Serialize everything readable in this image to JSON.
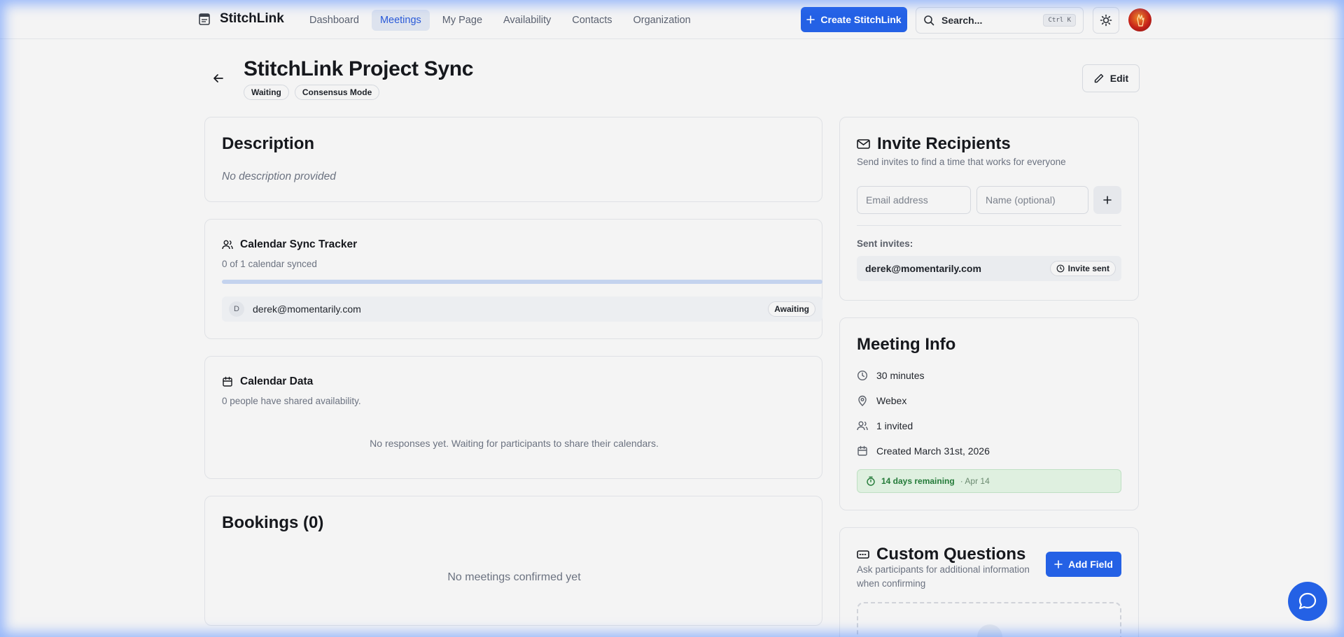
{
  "app": {
    "name": "StitchLink",
    "nav": [
      "Dashboard",
      "Meetings",
      "My Page",
      "Availability",
      "Contacts",
      "Organization"
    ],
    "active_nav": "Meetings",
    "create_button": "Create StitchLink",
    "search": {
      "label": "Search...",
      "shortcut": "Ctrl K"
    }
  },
  "meeting": {
    "title": "StitchLink Project Sync",
    "badges": [
      "Waiting",
      "Consensus Mode"
    ],
    "edit_label": "Edit"
  },
  "description": {
    "heading": "Description",
    "text": "No description provided"
  },
  "sync_tracker": {
    "heading": "Calendar Sync Tracker",
    "summary": "0 of 1 calendar synced",
    "progress": 0,
    "participants": [
      {
        "initial": "D",
        "email": "derek@momentarily.com",
        "status": "Awaiting"
      }
    ]
  },
  "calendar_data": {
    "heading": "Calendar Data",
    "summary": "0 people have shared availability.",
    "empty": "No responses yet. Waiting for participants to share their calendars."
  },
  "bookings": {
    "heading": "Bookings (0)",
    "empty": "No meetings confirmed yet"
  },
  "invite": {
    "heading": "Invite Recipients",
    "subtitle": "Send invites to find a time that works for everyone",
    "email_placeholder": "Email address",
    "name_placeholder": "Name (optional)",
    "sent_label": "Sent invites:",
    "sent": [
      {
        "email": "derek@momentarily.com",
        "status": "Invite sent"
      }
    ]
  },
  "meeting_info": {
    "heading": "Meeting Info",
    "duration": "30 minutes",
    "location": "Webex",
    "invited": "1 invited",
    "created": "Created March 31st, 2026",
    "remaining": "14 days remaining",
    "deadline": "· Apr 14"
  },
  "custom_questions": {
    "heading": "Custom Questions",
    "subtitle": "Ask participants for additional information when confirming",
    "add_label": "Add Field"
  },
  "colors": {
    "accent": "#2461e5",
    "success_bg": "#dff0e0",
    "success_text": "#237a38"
  }
}
